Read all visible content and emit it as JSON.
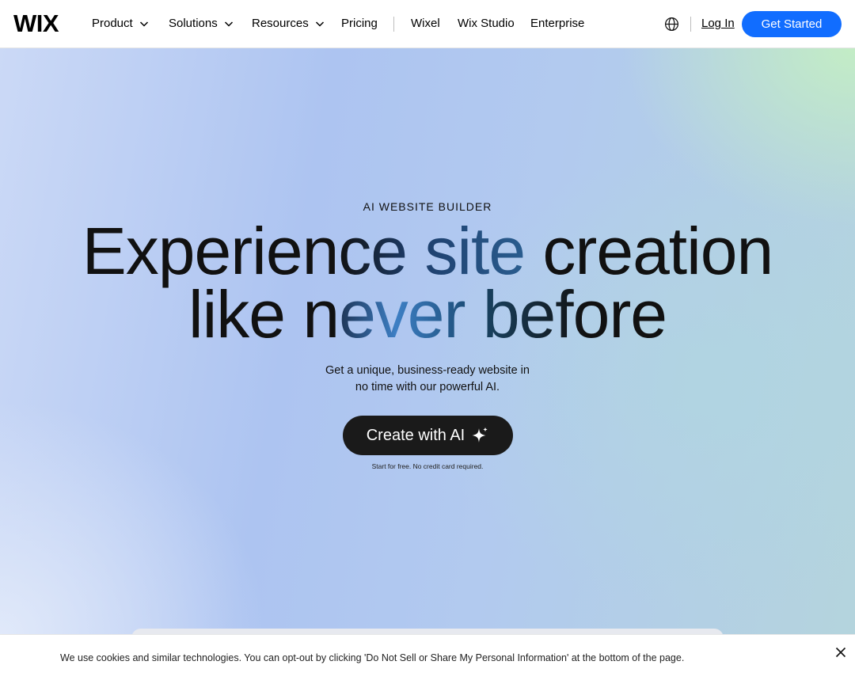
{
  "header": {
    "logo_text": "WIX",
    "nav": [
      {
        "label": "Product",
        "has_dropdown": true
      },
      {
        "label": "Solutions",
        "has_dropdown": true
      },
      {
        "label": "Resources",
        "has_dropdown": true
      },
      {
        "label": "Pricing",
        "has_dropdown": false
      },
      {
        "label": "Wixel",
        "has_dropdown": false
      },
      {
        "label": "Wix Studio",
        "has_dropdown": false
      },
      {
        "label": "Enterprise",
        "has_dropdown": false
      }
    ],
    "language_icon": "globe-icon",
    "login_label": "Log In",
    "get_started_label": "Get Started"
  },
  "hero": {
    "eyebrow": "AI WEBSITE BUILDER",
    "headline_line1_a": "Experien",
    "headline_line1_b": "ce site",
    "headline_line1_c": " creation",
    "headline_line2_a": "like n",
    "headline_line2_b": "ever",
    "headline_line2_c": " before",
    "subtitle_line1": "Get a unique, business-ready website in",
    "subtitle_line2": "no time with our powerful AI.",
    "cta_label": "Create with AI",
    "cta_icon": "sparkle-icon",
    "note": "Start for free. No credit card required."
  },
  "cookie_banner": {
    "text": "We use cookies and similar technologies. You can opt-out by clicking 'Do Not Sell or Share My Personal Information' at the bottom of the page.",
    "close_icon": "close-icon"
  },
  "colors": {
    "primary_button": "#116dff",
    "dark_button": "#1a1a1a",
    "text": "#111111",
    "hero_blue": "#adc4f1",
    "hero_green": "#c4eec4"
  }
}
